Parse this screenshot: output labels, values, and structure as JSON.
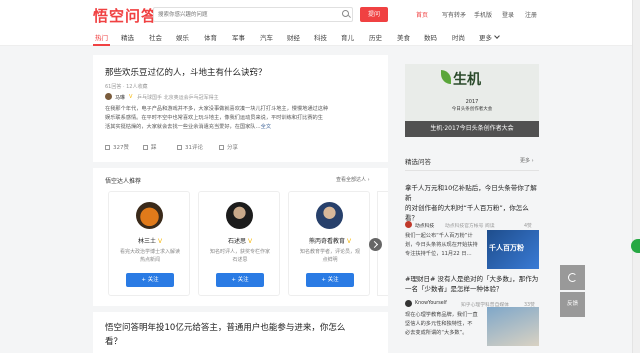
{
  "header": {
    "logo": "悟空问答",
    "search_placeholder": "搜索你感兴趣的问题",
    "ask_label": "提问",
    "links": [
      "首页",
      "写有转矛",
      "手机版",
      "登录",
      "注册"
    ]
  },
  "categories": [
    "热门",
    "精选",
    "社会",
    "娱乐",
    "体育",
    "军事",
    "汽车",
    "财经",
    "科技",
    "育儿",
    "历史",
    "美食",
    "数码",
    "时尚",
    "更多"
  ],
  "question1": {
    "title": "那些欢乐豆过亿的人，斗地主有什么诀窍？",
    "meta": "61回答 · 12人收藏",
    "author": "马琳",
    "author_desc": "乒乓球国手 北京奥运会乒乓冠军得主",
    "excerpt_lines": [
      "在我那个年代，电子产品和游戏并不多，大家没事做就喜欢凑一块儿打打斗地主，慢慢地通过这种",
      "娱乐联系感情。在平时不空中也常喜欢上玩斗地主，像我们运动员来说，平时训练和打比赛的生",
      "活其实挺枯燥的，大家就会去找一些业余消遣充当爱好，在国家队…"
    ],
    "more_label": "全文",
    "likes": "327赞",
    "dislike_label": "踩",
    "comments": "31评论",
    "share_label": "分享"
  },
  "experts": {
    "title": "悟空达人推荐",
    "see_all": "查看全部达人 ›",
    "items": [
      {
        "name": "林三土",
        "desc": "看完大政治学博士求入解读热点新闻",
        "follow": "+ 关注"
      },
      {
        "name": "石述思",
        "desc": "知名时评人，获奖专栏作家石述思",
        "follow": "+ 关注"
      },
      {
        "name": "熊丙奇看教育",
        "desc": "知名教育学者，评论员，观点鲜明",
        "follow": "+ 关注"
      }
    ]
  },
  "question2": {
    "title_lines": [
      "悟空问答明年投10亿元给答主，普通用户也能参与进来，你怎么",
      "看？"
    ]
  },
  "banner": {
    "logo": "生机",
    "year": "2017",
    "subtitle": "今日头条创作者大会",
    "caption": "生机·2017今日头条创作者大会"
  },
  "hot_qa": {
    "title": "精选问答",
    "more": "更多 ›",
    "items": [
      {
        "title_lines": [
          "拿千人万元和10亿补贴后，今日头条带你了解新",
          "的对创作者的大利时“千人百万粉”，你怎么",
          "看？"
        ],
        "author": "动点科技",
        "meta": "动点科技官方帐号 阅读",
        "likes": "4赞",
        "excerpt_lines": [
          "我们一起公布“千人百万粉”计",
          "划，今日头条将从现在开始扶持",
          "专注扶持千位，11月22 日…"
        ],
        "thumb_text": "千人百万粉"
      },
      {
        "title_lines": [
          "#理财日# 没有人是绝对的「大多数」，那作为",
          "一名「少数者」是怎样一种体验？"
        ],
        "author": "KnowYourself",
        "meta": "知乎心理学科普自媒体",
        "likes": "33赞",
        "excerpt_lines": [
          "现在心理学教育品牌，我们一直",
          "坚信人的多元性和独特性，不",
          "必去变成所谓的“大多数”。"
        ]
      }
    ]
  },
  "side": {
    "refresh_label": "",
    "feedback_label": "反馈"
  },
  "colors": {
    "accent": "#f04142",
    "follow": "#2a7be4",
    "link": "#406599"
  }
}
